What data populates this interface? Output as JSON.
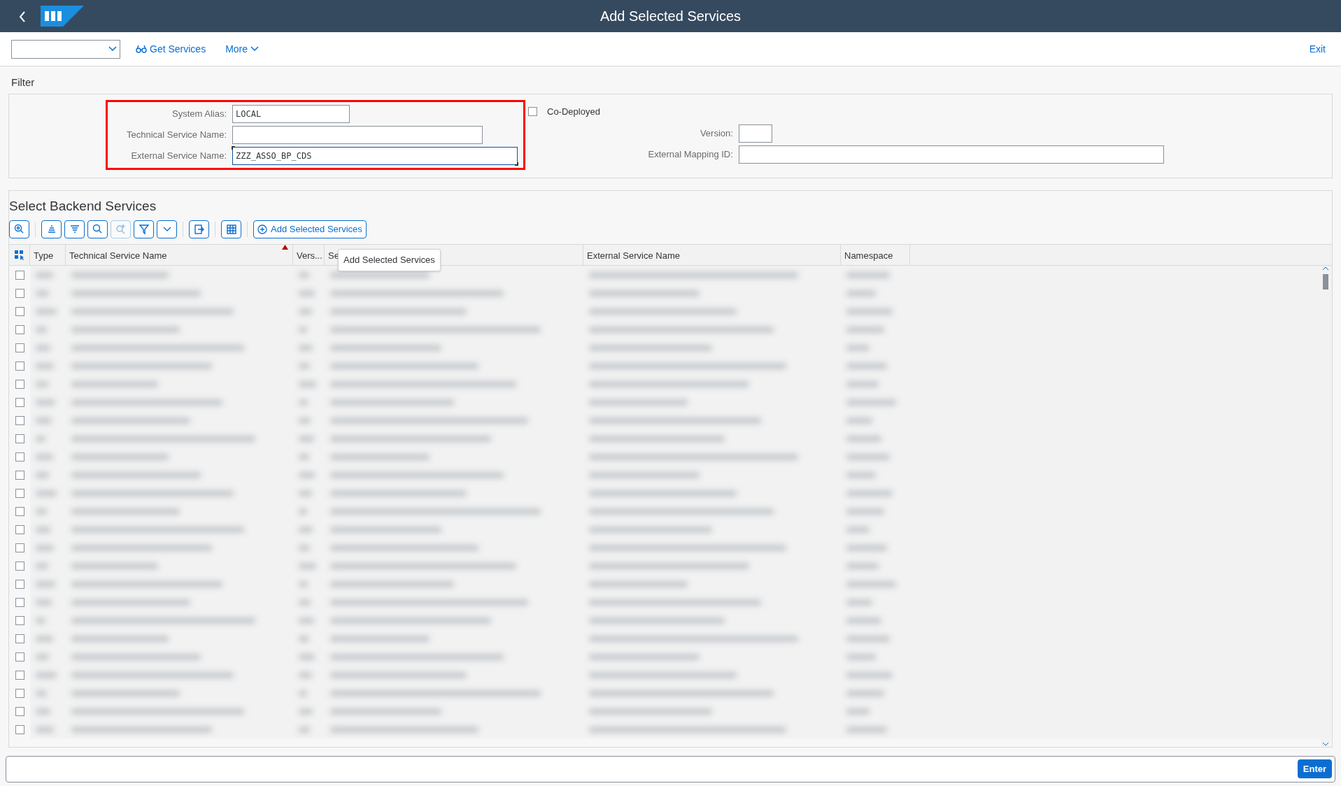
{
  "header": {
    "title": "Add Selected Services"
  },
  "toolbar": {
    "actions": [
      {
        "label": "Get Services",
        "kind": "glasses"
      },
      {
        "label": "More",
        "kind": "menu"
      }
    ],
    "exit": "Exit"
  },
  "filter": {
    "title": "Filter",
    "highlighted": true,
    "left_fields": [
      {
        "label": "System Alias:",
        "value": "LOCAL",
        "focused": false
      },
      {
        "label": "Technical Service Name:",
        "focused": false
      },
      {
        "label": "External Service Name:",
        "value": "ZZZ_ASSO_BP_CDS",
        "focused": true
      }
    ],
    "co_deployed": {
      "label": "Co-Deployed",
      "checked": false
    },
    "right_fields": [
      {
        "label": "Version:"
      },
      {
        "label": "External Mapping ID:"
      }
    ]
  },
  "services": {
    "title": "Select Backend Services",
    "tools": [
      {
        "kind": "zoom",
        "disabled": false
      },
      {
        "kind": "align-top",
        "disabled": false
      },
      {
        "kind": "align-center",
        "disabled": false
      },
      {
        "kind": "search",
        "disabled": false
      },
      {
        "kind": "search-plus",
        "disabled": true
      },
      {
        "kind": "filter",
        "disabled": false
      },
      {
        "kind": "filter-menu",
        "disabled": false
      },
      {
        "kind": "export",
        "disabled": false
      },
      {
        "kind": "grid",
        "disabled": false
      }
    ],
    "add_button": "Add Selected Services",
    "columns": [
      {
        "label": "Type",
        "sorted": false
      },
      {
        "label": "Technical Service Name",
        "sorted": true
      },
      {
        "label": "Vers...",
        "sorted": false
      },
      {
        "label": "Se",
        "sorted": false
      },
      {
        "label": "External Service Name",
        "sorted": false
      },
      {
        "label": "Namespace",
        "sorted": false
      }
    ],
    "tooltip": "Add Selected Services",
    "rows": [
      {
        "checked": false
      },
      {
        "checked": false
      },
      {
        "checked": false
      },
      {
        "checked": false
      },
      {
        "checked": false
      },
      {
        "checked": false
      },
      {
        "checked": false
      },
      {
        "checked": false
      },
      {
        "checked": false
      },
      {
        "checked": false
      },
      {
        "checked": false
      },
      {
        "checked": false
      },
      {
        "checked": false
      },
      {
        "checked": false
      },
      {
        "checked": false
      },
      {
        "checked": false
      },
      {
        "checked": false
      },
      {
        "checked": false
      },
      {
        "checked": false
      },
      {
        "checked": false
      },
      {
        "checked": false
      },
      {
        "checked": false
      },
      {
        "checked": false
      },
      {
        "checked": false
      },
      {
        "checked": false
      },
      {
        "checked": false
      }
    ]
  },
  "command_bar": {
    "button": "Enter"
  }
}
